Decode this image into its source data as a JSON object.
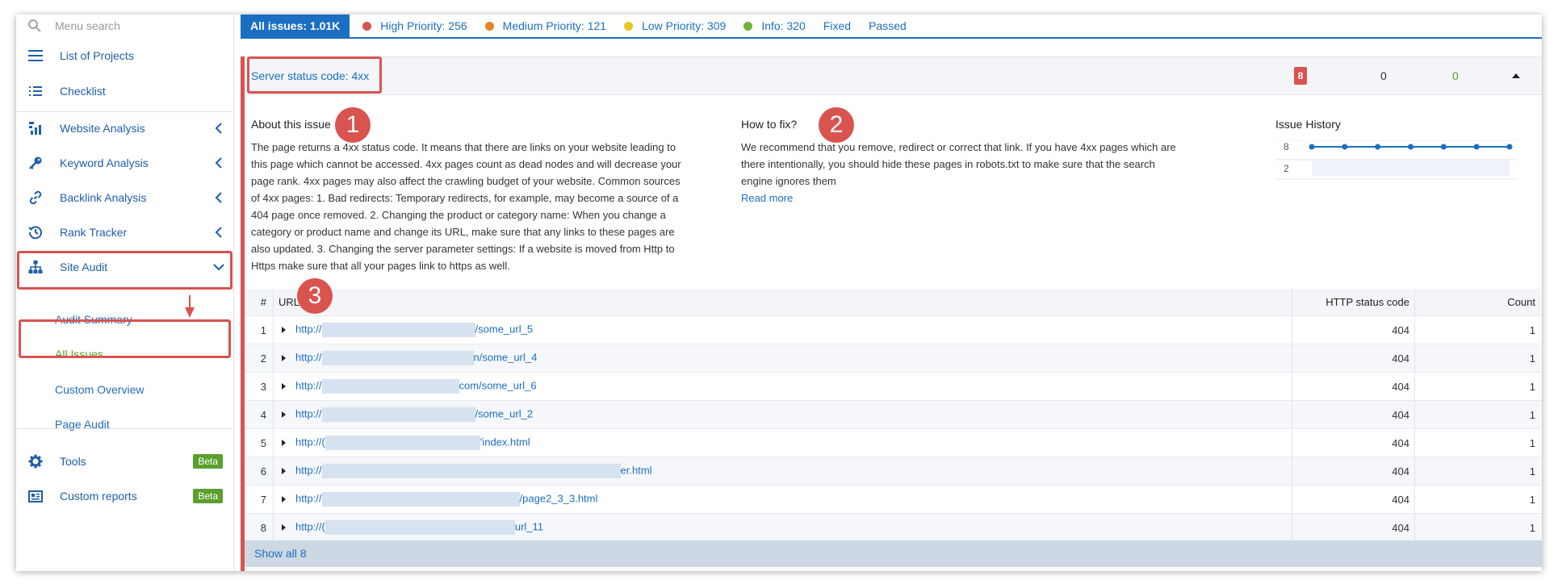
{
  "sidebar": {
    "search_placeholder": "Menu search",
    "items": [
      {
        "label": "List of Projects",
        "icon": "hamburger-icon"
      },
      {
        "label": "Checklist",
        "icon": "list-icon"
      },
      {
        "label": "Website Analysis",
        "icon": "analysis-icon"
      },
      {
        "label": "Keyword Analysis",
        "icon": "key-icon"
      },
      {
        "label": "Backlink Analysis",
        "icon": "link-icon"
      },
      {
        "label": "Rank Tracker",
        "icon": "history-icon"
      },
      {
        "label": "Site Audit",
        "icon": "sitemap-icon"
      }
    ],
    "site_audit_sub": [
      {
        "label": "Audit Summary"
      },
      {
        "label": "All Issues"
      },
      {
        "label": "Custom Overview"
      },
      {
        "label": "Page Audit"
      }
    ],
    "tools_label": "Tools",
    "tools_badge": "Beta",
    "custom_reports_label": "Custom reports",
    "custom_reports_badge": "Beta"
  },
  "tabs": {
    "all": "All issues: 1.01K",
    "high": "High Priority: 256",
    "medium": "Medium Priority: 121",
    "low": "Low Priority: 309",
    "info": "Info: 320",
    "fixed": "Fixed",
    "passed": "Passed",
    "colors": {
      "high": "#d9534f",
      "medium": "#e8832a",
      "low": "#e6c620",
      "info": "#6cb33e"
    }
  },
  "issue": {
    "title": "Server status code: 4xx",
    "count_red": "8",
    "count_zero": "0",
    "count_green": "0",
    "about_title": "About this issue",
    "about_lines": [
      "The page returns a 4xx status code. It means that there are links on your website leading to",
      "this page which cannot be accessed. 4xx pages count as dead nodes and will decrease your",
      "page rank. 4xx pages may also affect the crawling budget of your website. Common sources",
      "of 4xx pages: 1. Bad redirects: Temporary redirects, for example, may become a source of a",
      "404 page once removed. 2. Changing the product or category name: When you change a",
      "category or product name and change its URL, make sure that any links to these pages are",
      "also updated. 3. Changing the server parameter settings: If a website is moved from Http to",
      "Https make sure that all your pages link to https as well."
    ],
    "fix_title": "How to fix?",
    "fix_lines": [
      "We recommend that you remove, redirect or correct that link. If you have 4xx pages which are",
      "there intentionally, you should hide these pages in robots.txt to make sure that the search",
      "engine ignores them"
    ],
    "read_more": "Read more",
    "history_title": "Issue History",
    "history_y_top": "8",
    "history_y_bottom": "2",
    "history_values": [
      8,
      8,
      8,
      8,
      8,
      8,
      8
    ]
  },
  "annotations": {
    "one": "1",
    "two": "2",
    "three": "3"
  },
  "table": {
    "headers": {
      "num": "#",
      "url": "URL",
      "code": "HTTP status code",
      "count": "Count"
    },
    "rows": [
      {
        "num": "1",
        "url_start": "http://",
        "url_end": "/some_url_5",
        "code": "404",
        "count": "1"
      },
      {
        "num": "2",
        "url_start": "http://",
        "url_end": "n/some_url_4",
        "code": "404",
        "count": "1"
      },
      {
        "num": "3",
        "url_start": "http://",
        "url_end": "com/some_url_6",
        "code": "404",
        "count": "1"
      },
      {
        "num": "4",
        "url_start": "http://",
        "url_end": "/some_url_2",
        "code": "404",
        "count": "1"
      },
      {
        "num": "5",
        "url_start": "http://(",
        "url_end": "'index.html",
        "code": "404",
        "count": "1"
      },
      {
        "num": "6",
        "url_start": "http://",
        "url_end": "er.html",
        "code": "404",
        "count": "1"
      },
      {
        "num": "7",
        "url_start": "http://",
        "url_end": "/page2_3_3.html",
        "code": "404",
        "count": "1"
      },
      {
        "num": "8",
        "url_start": "http://(",
        "url_end": "url_11",
        "code": "404",
        "count": "1"
      }
    ],
    "show_all": "Show all 8"
  }
}
